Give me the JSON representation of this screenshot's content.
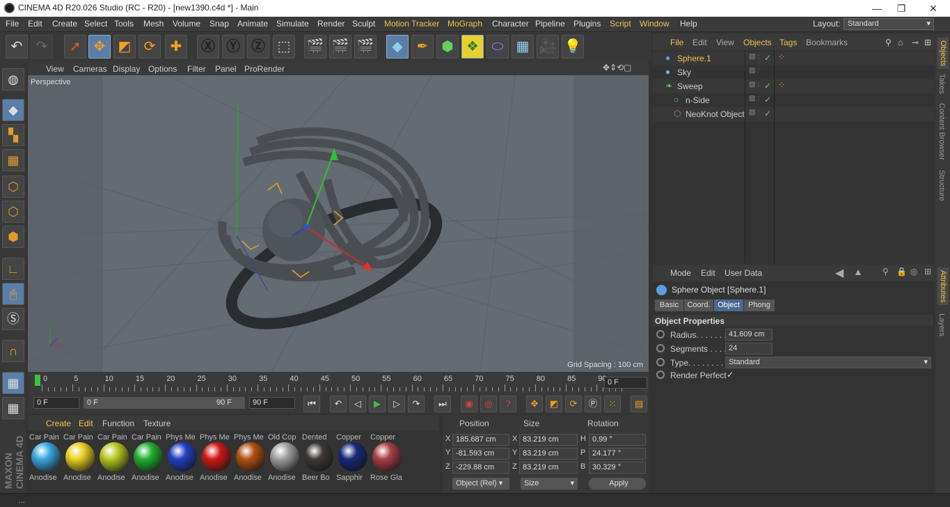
{
  "title": "CINEMA 4D R20.026 Studio (RC - R20) - [new1390.c4d *] - Main",
  "menubar": {
    "items": [
      "File",
      "Edit",
      "Create",
      "Select",
      "Tools",
      "Mesh",
      "Volume",
      "Snap",
      "Animate",
      "Simulate",
      "Render",
      "Sculpt",
      "Motion Tracker",
      "MoGraph",
      "Character",
      "Pipeline",
      "Plugins",
      "Script",
      "Window",
      "Help"
    ],
    "layout_label": "Layout:",
    "layout_value": "Standard"
  },
  "viewport": {
    "menu": [
      "View",
      "Cameras",
      "Display",
      "Options",
      "Filter",
      "Panel",
      "ProRender"
    ],
    "label": "Perspective",
    "grid_spacing": "Grid Spacing : 100 cm"
  },
  "timeline": {
    "ticks": [
      "0",
      "5",
      "10",
      "15",
      "20",
      "25",
      "30",
      "35",
      "40",
      "45",
      "50",
      "55",
      "60",
      "65",
      "70",
      "75",
      "80",
      "85",
      "90"
    ],
    "frame_field": "0 F"
  },
  "transport": {
    "start": "0 F",
    "range_start": "0 F",
    "range_end": "90 F",
    "end": "90 F"
  },
  "materials": {
    "menu": [
      "Create",
      "Edit",
      "Function",
      "Texture"
    ],
    "items": [
      {
        "top": "Car Pain",
        "bottom": "Anodise",
        "color": "#3aa8e0"
      },
      {
        "top": "Car Pain",
        "bottom": "Anodise",
        "color": "#e8d020"
      },
      {
        "top": "Car Pain",
        "bottom": "Anodise",
        "color": "#b8c820"
      },
      {
        "top": "Car Pain",
        "bottom": "Anodise",
        "color": "#20b030"
      },
      {
        "top": "Phys Me",
        "bottom": "Anodise",
        "color": "#2040c0"
      },
      {
        "top": "Phys Me",
        "bottom": "Anodise",
        "color": "#d01818"
      },
      {
        "top": "Phys Me",
        "bottom": "Anodise",
        "color": "#b05010"
      },
      {
        "top": "Old Cop",
        "bottom": "Anodise",
        "color": "#a0a0a0"
      },
      {
        "top": "Dented",
        "bottom": "Beer Bo",
        "color": "#403838"
      },
      {
        "top": "Copper",
        "bottom": "Sapphir",
        "color": "#182878"
      },
      {
        "top": "Copper",
        "bottom": "Rose Gla",
        "color": "#a84048"
      }
    ]
  },
  "coords": {
    "headers": [
      "Position",
      "Size",
      "Rotation"
    ],
    "rows": [
      {
        "axis": "X",
        "pos": "185.687 cm",
        "saxis": "X",
        "size": "83.219 cm",
        "raxis": "H",
        "rot": "0.99 °"
      },
      {
        "axis": "Y",
        "pos": "-81.593 cm",
        "saxis": "Y",
        "size": "83.219 cm",
        "raxis": "P",
        "rot": "24.177 °"
      },
      {
        "axis": "Z",
        "pos": "-229.88 cm",
        "saxis": "Z",
        "size": "83.219 cm",
        "raxis": "B",
        "rot": "30.329 °"
      }
    ],
    "mode": "Object (Rel)",
    "size_mode": "Size",
    "apply": "Apply"
  },
  "objects": {
    "menu": [
      "File",
      "Edit",
      "View",
      "Objects",
      "Tags",
      "Bookmarks"
    ],
    "items": [
      {
        "name": "Sphere.1",
        "selected": true
      },
      {
        "name": "Sky",
        "selected": false
      },
      {
        "name": "Sweep",
        "selected": false
      },
      {
        "name": "n-Side",
        "selected": false
      },
      {
        "name": "NeoKnot Object",
        "selected": false
      }
    ]
  },
  "attributes": {
    "menu": [
      "Mode",
      "Edit",
      "User Data"
    ],
    "title": "Sphere Object [Sphere.1]",
    "tabs": [
      "Basic",
      "Coord.",
      "Object",
      "Phong"
    ],
    "section": "Object Properties",
    "radius_label": "Radius. . . . . . .",
    "radius": "41.609 cm",
    "segments_label": "Segments . . . .",
    "segments": "24",
    "type_label": "Type. . . . . . . . .",
    "type": "Standard",
    "render_label": "Render Perfect",
    "render_check": "✓"
  },
  "right_tabs": [
    "Objects",
    "Takes",
    "Content Browser",
    "Structure",
    "Attributes",
    "Layers"
  ],
  "status": "..."
}
